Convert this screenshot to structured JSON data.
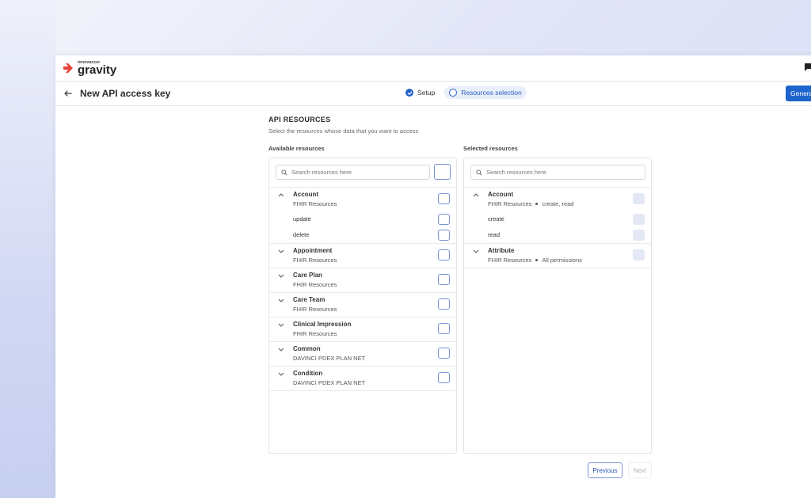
{
  "brand": {
    "small_text": "innovaccer",
    "name": "gravity"
  },
  "header": {
    "title": "New API access key",
    "steps": [
      {
        "label": "Setup",
        "state": "done"
      },
      {
        "label": "Resources selection",
        "state": "current"
      }
    ],
    "generate_label": "Genera"
  },
  "api_resources": {
    "title": "API RESOURCES",
    "subtitle": "Select the resources whose data that you want to access"
  },
  "available": {
    "label": "Available resources",
    "search_placeholder": "Search resources here",
    "groups": [
      {
        "title": "Account",
        "sub": "FHIR Resources",
        "expanded": true,
        "items": [
          "update",
          "delete"
        ]
      },
      {
        "title": "Appointment",
        "sub": "FHIR Resources"
      },
      {
        "title": "Care Plan",
        "sub": "FHIR Resources"
      },
      {
        "title": "Care Team",
        "sub": "FHIR Resources"
      },
      {
        "title": "Clinical Impression",
        "sub": "FHIR Resources"
      },
      {
        "title": "Common",
        "sub": "DAVINCI PDEX PLAN NET"
      },
      {
        "title": "Condition",
        "sub": "DAVINCI PDEX PLAN NET"
      }
    ]
  },
  "selected": {
    "label": "Selected resources",
    "search_placeholder": "Search resources here",
    "groups": [
      {
        "title": "Account",
        "sub": "FHIR Resources",
        "perm": "create, read",
        "expanded": true,
        "items": [
          "create",
          "read"
        ]
      },
      {
        "title": "Attribute",
        "sub": "FHIR Resources",
        "perm": "All permissions"
      }
    ]
  },
  "pager": {
    "previous": "Previous",
    "next": "Next"
  },
  "colors": {
    "primary": "#1d64cc",
    "step_active_bg": "#e8eefa",
    "brand_red": "#e8453c"
  }
}
